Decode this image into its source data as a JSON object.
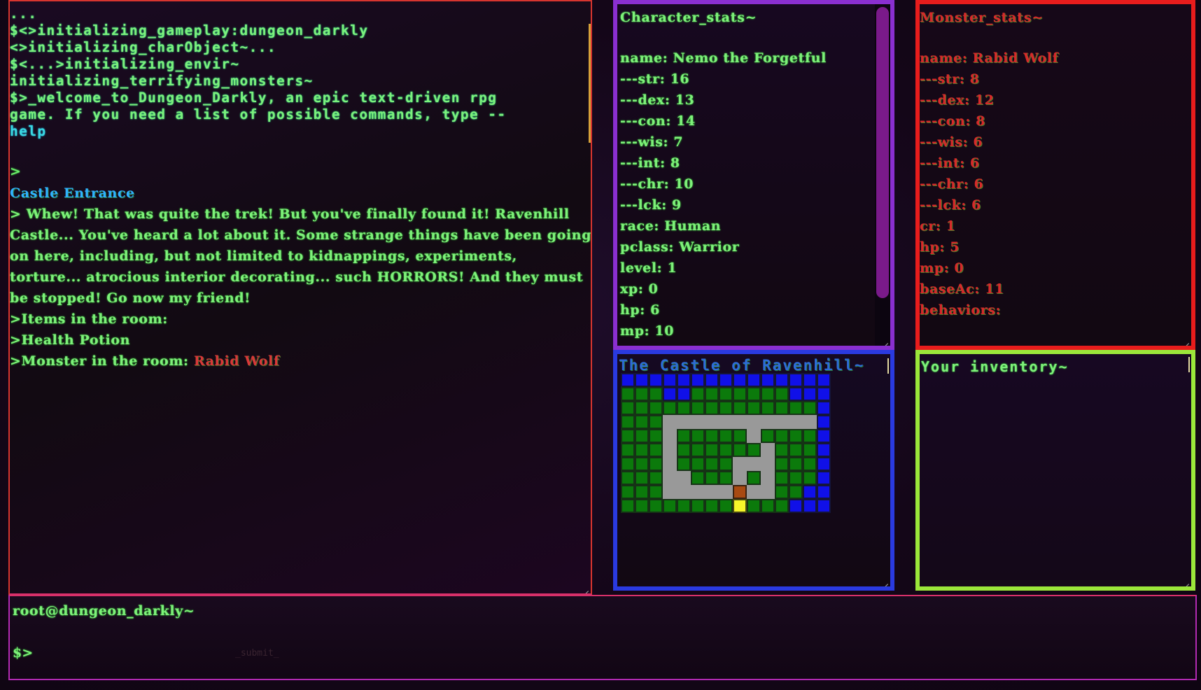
{
  "terminal": {
    "boot_lines": [
      "...",
      "$<>initializing_gameplay:dungeon_darkly",
      "<>initializing_charObject~...",
      "$<...>initializing_envir~",
      "initializing_terrifying_monsters~",
      "$>_welcome_to_Dungeon_Darkly, an epic text-driven rpg",
      "game. If you need a list of possible commands, type --"
    ],
    "help_word": "help",
    "prompt_symbol": ">",
    "location": "Castle Entrance",
    "description": "> Whew! That was quite the trek! But you've finally found it! Ravenhill Castle... You've heard a lot about it. Some strange things have been going on here, including, but not limited to kidnappings, experiments, torture... atrocious interior decorating... such HORRORS! And they must be stopped! Go now my friend!",
    "items_header": ">Items in the room:",
    "items": [
      ">Health Potion"
    ],
    "monster_prefix": ">Monster in the room: ",
    "monster_name": "Rabid Wolf"
  },
  "character": {
    "title": "Character_stats~",
    "stats": [
      "name: Nemo the Forgetful",
      "---str: 16",
      "---dex: 13",
      "---con: 14",
      "---wis: 7",
      "---int: 8",
      "---chr: 10",
      "---lck: 9",
      "race: Human",
      "pclass: Warrior",
      "level: 1",
      "xp: 0",
      "hp: 6",
      "mp: 10"
    ]
  },
  "monster": {
    "title": "Monster_stats~",
    "stats": [
      "name: Rabid Wolf",
      "---str: 8",
      "---dex: 12",
      "---con: 8",
      "---wis: 6",
      "---int: 6",
      "---chr: 6",
      "---lck: 6",
      "cr: 1",
      "hp: 5",
      "mp: 0",
      "baseAc: 11",
      "behaviors:"
    ]
  },
  "map": {
    "title": "The Castle of Ravenhill~",
    "rows": [
      "wwwwwwwwwwwwwww",
      "gggwwgggggggwww",
      "ggggggggggggggw",
      "ggg...........w",
      "ggg.ggggg.ggggw",
      "ggg.gggggg.gggw",
      "ggg.gggg...gggw",
      "ggg..ggg.g.gggw",
      "ggg.....D..ggww",
      "ggggggggPgggwww"
    ],
    "legend": {
      "w": "water",
      "g": "grass",
      ".": "floor",
      "D": "door",
      "P": "player"
    }
  },
  "inventory": {
    "title": "Your inventory~",
    "items": []
  },
  "command": {
    "host": "root@dungeon_darkly~",
    "prompt": "$>",
    "input_value": "",
    "submit_label": "_submit_"
  },
  "colors": {
    "terminal_text": "#7ef07a",
    "location_blue": "#2fb0ff",
    "monster_red": "#d83838",
    "char_border": "#8a2fd0",
    "monster_border": "#e81c1c",
    "map_border": "#2a3ae0",
    "inventory_border": "#9be63a"
  }
}
